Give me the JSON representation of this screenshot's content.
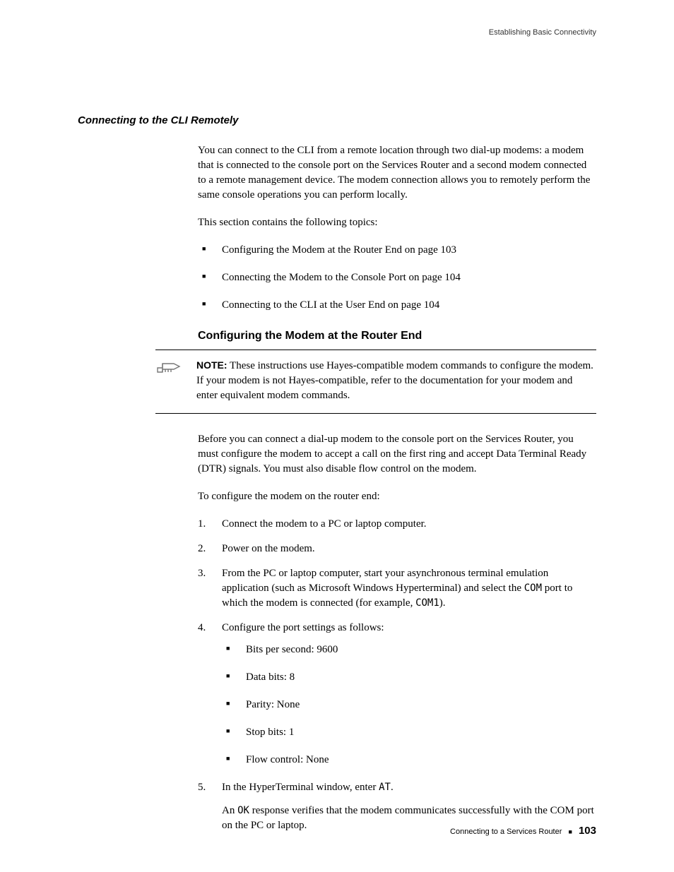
{
  "running_head": "Establishing Basic Connectivity",
  "section_title": "Connecting to the CLI Remotely",
  "intro_para": "You can connect to the CLI from a remote location through two dial-up modems: a modem that is connected to the console port on the Services Router and a second modem connected to a remote management device. The modem connection allows you to remotely perform the same console operations you can perform locally.",
  "topics_lead": "This section contains the following topics:",
  "topics": [
    "Configuring the Modem at the Router End on page 103",
    "Connecting the Modem to the Console Port on page 104",
    "Connecting to the CLI at the User End on page 104"
  ],
  "sub_heading": "Configuring the Modem at the Router End",
  "note_label": "NOTE:",
  "note_text": " These instructions use Hayes-compatible modem commands to configure the modem. If your modem is not Hayes-compatible, refer to the documentation for your modem and enter equivalent modem commands.",
  "pre_steps_para": "Before you can connect a dial-up modem to the console port on the Services Router, you must configure the modem to accept a call on the first ring and accept Data Terminal Ready (DTR) signals. You must also disable flow control on the modem.",
  "steps_lead": "To configure the modem on the router end:",
  "step1": "Connect the modem to a PC or laptop computer.",
  "step2": "Power on the modem.",
  "step3_a": "From the PC or laptop computer, start your asynchronous terminal emulation application (such as Microsoft Windows Hyperterminal) and select the ",
  "step3_com": "COM",
  "step3_b": " port to which the modem is connected (for example, ",
  "step3_com1": "COM1",
  "step3_c": ").",
  "step4_lead": "Configure the port settings as follows:",
  "port_settings": [
    "Bits per second: 9600",
    "Data bits: 8",
    "Parity: None",
    "Stop bits: 1",
    "Flow control: None"
  ],
  "step5_a": "In the HyperTerminal window, enter ",
  "step5_at": "AT",
  "step5_b": ".",
  "step5_sub_a": "An ",
  "step5_ok": "OK",
  "step5_sub_b": " response verifies that the modem communicates successfully with the COM port on the PC or laptop.",
  "footer_text": "Connecting to a Services Router",
  "page_number": "103"
}
